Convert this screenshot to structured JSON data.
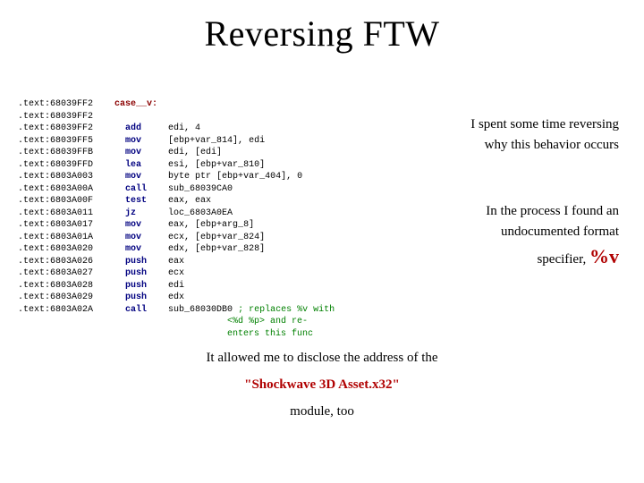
{
  "title": "Reversing FTW",
  "disasm": [
    {
      "addr": ".text:68039FF2",
      "mnem": "case__v:",
      "op": ""
    },
    {
      "addr": ".text:68039FF2",
      "mnem": "",
      "op": ""
    },
    {
      "addr": ".text:68039FF2",
      "mnem": "add",
      "op": "edi, 4"
    },
    {
      "addr": ".text:68039FF5",
      "mnem": "mov",
      "op": "[ebp+var_814], edi"
    },
    {
      "addr": ".text:68039FFB",
      "mnem": "mov",
      "op": "edi, [edi]"
    },
    {
      "addr": ".text:68039FFD",
      "mnem": "lea",
      "op": "esi, [ebp+var_810]"
    },
    {
      "addr": ".text:6803A003",
      "mnem": "mov",
      "op": "byte ptr [ebp+var_404], 0"
    },
    {
      "addr": ".text:6803A00A",
      "mnem": "call",
      "op": "sub_68039CA0"
    },
    {
      "addr": ".text:6803A00F",
      "mnem": "test",
      "op": "eax, eax"
    },
    {
      "addr": ".text:6803A011",
      "mnem": "jz",
      "op": "loc_6803A0EA"
    },
    {
      "addr": ".text:6803A017",
      "mnem": "mov",
      "op": "eax, [ebp+arg_8]"
    },
    {
      "addr": ".text:6803A01A",
      "mnem": "mov",
      "op": "ecx, [ebp+var_824]"
    },
    {
      "addr": ".text:6803A020",
      "mnem": "mov",
      "op": "edx, [ebp+var_828]"
    },
    {
      "addr": ".text:6803A026",
      "mnem": "push",
      "op": "eax"
    },
    {
      "addr": ".text:6803A027",
      "mnem": "push",
      "op": "ecx"
    },
    {
      "addr": ".text:6803A028",
      "mnem": "push",
      "op": "edi"
    },
    {
      "addr": ".text:6803A029",
      "mnem": "push",
      "op": "edx"
    },
    {
      "addr": ".text:6803A02A",
      "mnem": "call",
      "op": "sub_68030DB0 ; replaces %v with\n                                       <%d %p> and re-\n                                       enters this func"
    }
  ],
  "right1_a": "I spent some time reversing",
  "right1_b": "why this behavior occurs",
  "right2_a": "In the process I found an",
  "right2_b": "undocumented format",
  "right2_c": "specifier, ",
  "pv": "%v",
  "bottom1": "It allowed me to disclose the address of the",
  "modname": "\"Shockwave 3D Asset.x32\"",
  "bottom3": "module, too"
}
